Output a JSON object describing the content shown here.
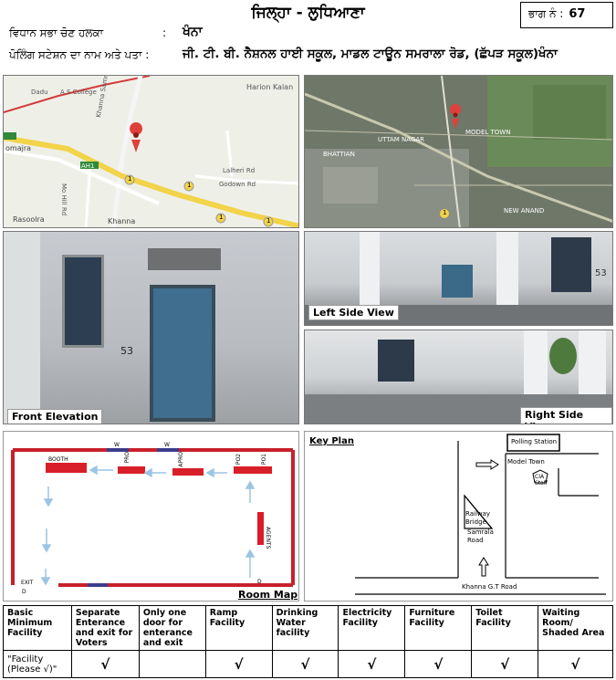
{
  "header": {
    "district": "ਜਿਲ੍ਹਾ - ਲੁਧਿਆਣਾ",
    "part_label": "ਭਾਗ ਨੰ :",
    "part_number": "67",
    "constituency_label": "ਵਿਧਾਨ ਸਭਾ ਚੋਣ ਹਲਕਾ",
    "constituency_value": "ਖੰਨਾ",
    "station_label": "ਪੋਲਿੰਗ ਸਟੇਸ਼ਨ ਦਾ ਨਾਮ ਅਤੇ ਪਤਾ :",
    "station_colon": ":",
    "station_value": "ਜੀ. ਟੀ. ਬੀ. ਨੈਸ਼ਨਲ ਹਾਈ ਸਕੂਲ, ਮਾਡਲ ਟਾਊਨ ਸਮਰਾਲਾ ਰੋਡ, (ਛੱਪੜ ਸਕੂਲ)ਖੰਨਾ"
  },
  "map": {
    "labels": [
      "Harion Kalan",
      "Dadu",
      "A S College",
      "Khanna Samrala Rd",
      "AH1",
      "Mo Hill Rd",
      "omajra",
      "Rasoolra",
      "Khanna",
      "Godown Rd",
      "Lalheri Rd",
      "1",
      "1",
      "1",
      "1"
    ]
  },
  "satellite": {
    "labels": [
      "MODEL TOWN",
      "UTTAM NAGAR",
      "BHATTIAN",
      "NEW ANAND",
      "1"
    ]
  },
  "photos": {
    "front_caption": "Front Elevation",
    "left_caption": "Left Side View",
    "right_caption": "Right Side View",
    "wall_text": "53"
  },
  "room_map": {
    "title": "Room Map",
    "labels": {
      "booth": "BOOTH",
      "pro": "PRO",
      "apro": "APRO",
      "po2": "PO2",
      "po1": "PO1",
      "agents": "AGENTS",
      "exit": "EXIT",
      "d_exit": "D",
      "d_entry": "D",
      "w1": "W",
      "w2": "W"
    }
  },
  "key_plan": {
    "title": "Key Plan",
    "polling_station": "Polling Station",
    "model_town": "Model Town",
    "cia_staff": "CIA Staff",
    "railway_bridge": "Railway Bridge",
    "samrala_road": "Samrala Road",
    "gt_road": "Khanna G.T Road"
  },
  "facilities": {
    "row_label": "\"Facility (Please √)\"",
    "headers": [
      "Basic Minimum Facility",
      "Separate Enterance and exit for Voters",
      "Only one door for enterance and exit",
      "Ramp Facility",
      "Drinking Water facility",
      "Electricity Facility",
      "Furniture Facility",
      "Toilet Facility",
      "Waiting Room/ Shaded Area"
    ],
    "marks": [
      "√",
      "",
      "√",
      "√",
      "√",
      "√",
      "√",
      "√"
    ]
  },
  "colors": {
    "room_wall": "#c8202a",
    "room_window": "#3c3c8c",
    "arrow": "#9cc4e4"
  }
}
